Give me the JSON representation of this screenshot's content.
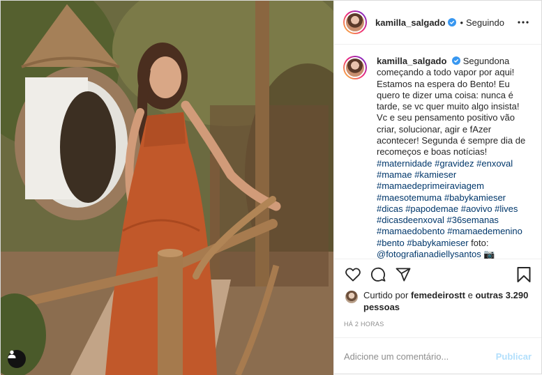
{
  "post": {
    "author": {
      "username": "kamilla_salgado",
      "verified": true,
      "follow_state": "Seguindo",
      "separator": "•"
    },
    "caption": {
      "username": "kamilla_salgado",
      "text": "Segundona começando a todo vapor por aqui! Estamos na espera do Bento! Eu quero te dizer uma coisa: nunca é tarde, se vc quer muito algo insista! Vc e seu pensamento positivo vão criar, solucionar, agir e fAzer acontecer! Segunda é sempre dia de recomeços e boas notícias!",
      "hashtags": [
        "#maternidade",
        "#gravidez",
        "#enxoval",
        "#mamae",
        "#kamieser",
        "#mamaedeprimeiraviagem",
        "#maesotemuma",
        "#babykamieser",
        "#dicas",
        "#papodemae",
        "#aovivo",
        "#lives",
        "#dicasdeenxoval",
        "#36semanas",
        "#mamaedobento",
        "#mamaedemenino",
        "#bento",
        "#babykamieser"
      ],
      "credit_label": "foto:",
      "credit_handle": "@fotografianadiellysantos",
      "camera_emoji": "📷"
    },
    "age": "2 h",
    "likes": {
      "prefix": "Curtido por",
      "liker": "femedeirostt",
      "connector": "e",
      "others": "outras 3.290 pessoas"
    },
    "timestamp": "HÁ 2 HORAS",
    "comment_input": {
      "placeholder": "Adicione um comentário...",
      "value": ""
    },
    "publish_label": "Publicar"
  },
  "icons": {
    "more": "more-options-icon",
    "like": "heart-icon",
    "comment": "comment-icon",
    "share": "paper-plane-icon",
    "save": "bookmark-icon",
    "verified": "verified-badge-icon",
    "user_tag": "user-tag-icon"
  },
  "colors": {
    "text": "#262626",
    "secondary": "#8e8e8e",
    "hashtag": "#00376b",
    "verified": "#3897f0",
    "publish_disabled": "#b2dffc",
    "border": "#dbdbdb"
  }
}
